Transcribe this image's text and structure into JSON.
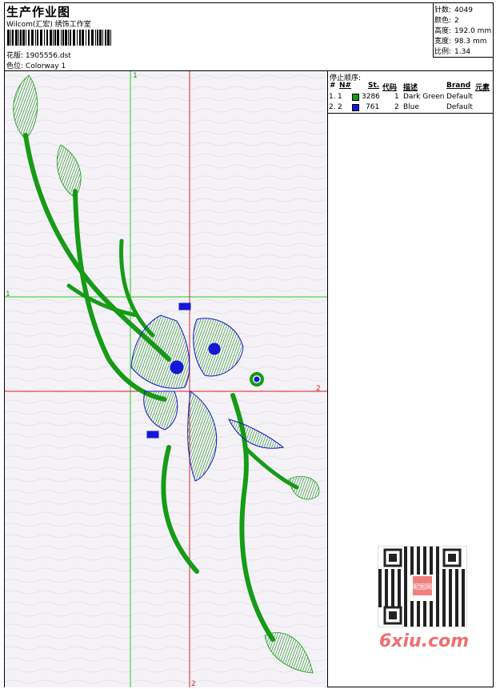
{
  "header": {
    "title": "生产作业图",
    "company": "Wilcom(汇宏) 绣饰工作室",
    "design_label": "花版:",
    "design_file": "1905556.dst",
    "colorway_label": "色位:",
    "colorway": "Colorway 1"
  },
  "stats": [
    {
      "label": "针数:",
      "value": "4049"
    },
    {
      "label": "颜色:",
      "value": "2"
    },
    {
      "label": "高度:",
      "value": "192.0 mm"
    },
    {
      "label": "宽度:",
      "value": "98.3 mm"
    },
    {
      "label": "比例:",
      "value": "1.34"
    }
  ],
  "stop_sequence": {
    "title": "停止顺序:",
    "headers": {
      "num": "#",
      "needle": "N#",
      "stitches": "St.",
      "code": "代码",
      "desc": "描述",
      "brand": "Brand",
      "element": "元素"
    },
    "rows": [
      {
        "num": "1.",
        "needle": "1",
        "color": "#169b16",
        "stitches": "3286",
        "code": "1",
        "desc": "Dark Green",
        "brand": "Default"
      },
      {
        "num": "2.",
        "needle": "2",
        "color": "#1616d8",
        "stitches": "761",
        "code": "2",
        "desc": "Blue",
        "brand": "Default"
      }
    ]
  },
  "guides": {
    "green_v": "1",
    "green_h": "1",
    "red_h": "2",
    "red_v": "2"
  },
  "watermark": {
    "seal": "昵图网",
    "site": "6xiu.com"
  },
  "colors": {
    "thread_green": "#169b16",
    "thread_blue": "#1616d8",
    "guide_green": "#22cc22",
    "guide_red": "#dd2222",
    "canvas_bg": "#f4f2f6",
    "watermark": "#ef6f72"
  }
}
